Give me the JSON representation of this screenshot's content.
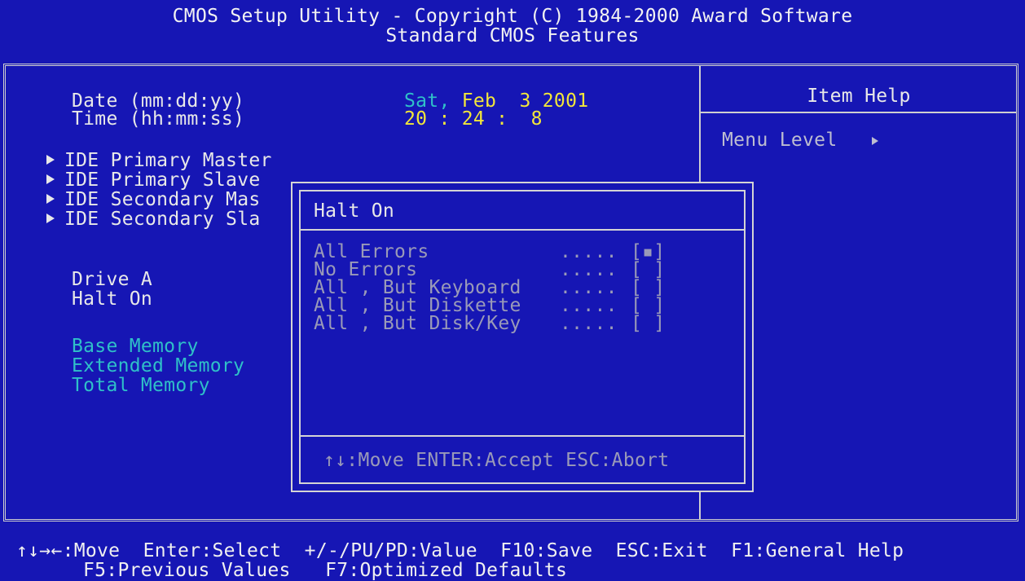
{
  "header": {
    "line1": "CMOS Setup Utility - Copyright (C) 1984-2000 Award Software",
    "line2": "Standard CMOS Features"
  },
  "main": {
    "date_label": "Date (mm:dd:yy)",
    "time_label": "Time (hh:mm:ss)",
    "date_value_day": "Sat,",
    "date_value_rest": "Feb  3 2001",
    "time_value": "20 : 24 :  8",
    "ide_items": [
      {
        "label": "IDE Primary Master"
      },
      {
        "label": "IDE Primary Slave"
      },
      {
        "label": "IDE Secondary Mas"
      },
      {
        "label": "IDE Secondary Sla"
      }
    ],
    "drive_a_label": "Drive A",
    "halt_on_label": "Halt On",
    "memory": {
      "base": "Base Memory",
      "extended": "Extended Memory",
      "total": "Total Memory"
    }
  },
  "help_panel": {
    "title": "Item Help",
    "menu_level": "Menu Level"
  },
  "popup": {
    "title": "Halt On",
    "options": [
      {
        "label": "All Errors",
        "dots": ".....",
        "box": "[▪]",
        "selected": true
      },
      {
        "label": "No Errors",
        "dots": ".....",
        "box": "[ ]",
        "selected": false
      },
      {
        "label": "All , But Keyboard",
        "dots": ".....",
        "box": "[ ]",
        "selected": false
      },
      {
        "label": "All , But Diskette",
        "dots": ".....",
        "box": "[ ]",
        "selected": false
      },
      {
        "label": "All , But Disk/Key",
        "dots": ".....",
        "box": "[ ]",
        "selected": false
      }
    ],
    "hint": "↑↓:Move ENTER:Accept ESC:Abort"
  },
  "footer": {
    "line1": "↑↓→←:Move  Enter:Select  +/-/PU/PD:Value  F10:Save  ESC:Exit  F1:General Help",
    "line2": "F5:Previous Values   F7:Optimized Defaults"
  },
  "colors": {
    "background": "#1616b4",
    "value_yellow": "#f2e63a",
    "info_cyan": "#2fc0c8",
    "disabled_grey": "#9a9ab8"
  }
}
